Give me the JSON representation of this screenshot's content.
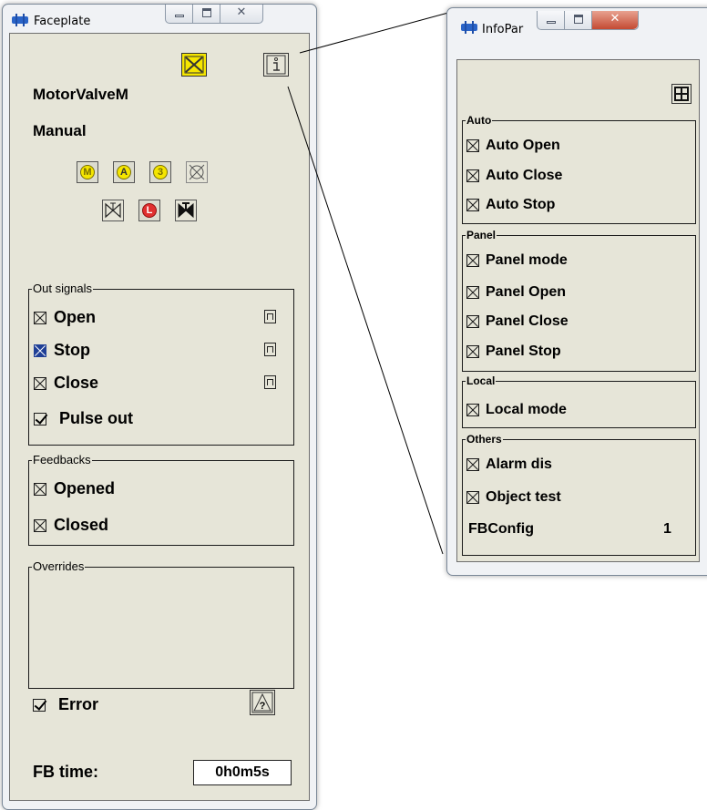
{
  "faceplate": {
    "title": "Faceplate",
    "close_glyph": "☒",
    "info_glyph": "i",
    "object_name": "MotorValveM",
    "mode": "Manual",
    "mode_buttons": [
      "M",
      "A",
      "3"
    ],
    "local_button": "L",
    "out_signals": {
      "label": "Out signals",
      "items": [
        {
          "label": "Open",
          "state": "crossed"
        },
        {
          "label": "Stop",
          "state": "active"
        },
        {
          "label": "Close",
          "state": "crossed"
        }
      ],
      "pulse_out": "Pulse out"
    },
    "feedbacks": {
      "label": "Feedbacks",
      "items": [
        {
          "label": "Opened"
        },
        {
          "label": "Closed"
        }
      ]
    },
    "overrides": {
      "label": "Overrides"
    },
    "error_label": "Error",
    "help_glyph": "?",
    "fb_time_label": "FB time:",
    "fb_time_value": "0h0m5s"
  },
  "infopar": {
    "title": "InfoPar",
    "groups": [
      {
        "label": "Auto",
        "items": [
          "Auto Open",
          "Auto Close",
          "Auto Stop"
        ]
      },
      {
        "label": "Panel",
        "items": [
          "Panel mode",
          "Panel Open",
          "Panel Close",
          "Panel Stop"
        ]
      },
      {
        "label": "Local",
        "items": [
          "Local mode"
        ]
      },
      {
        "label": "Others",
        "items": [
          "Alarm dis",
          "Object test"
        ]
      }
    ],
    "fbconfig_label": "FBConfig",
    "fbconfig_value": "1"
  },
  "colors": {
    "panel_bg": "#e6e5d8",
    "accent_yellow": "#f5e600",
    "stop_active": "#1f3f96",
    "local_red": "#e03030"
  },
  "icons": [
    "acknowledge-icon",
    "info-icon",
    "manual-mode-icon",
    "auto-mode-icon",
    "mode-3-icon",
    "disabled-icon",
    "valve-open-icon",
    "local-icon",
    "valve-close-icon",
    "pulse-icon",
    "help-icon",
    "grid-icon"
  ]
}
